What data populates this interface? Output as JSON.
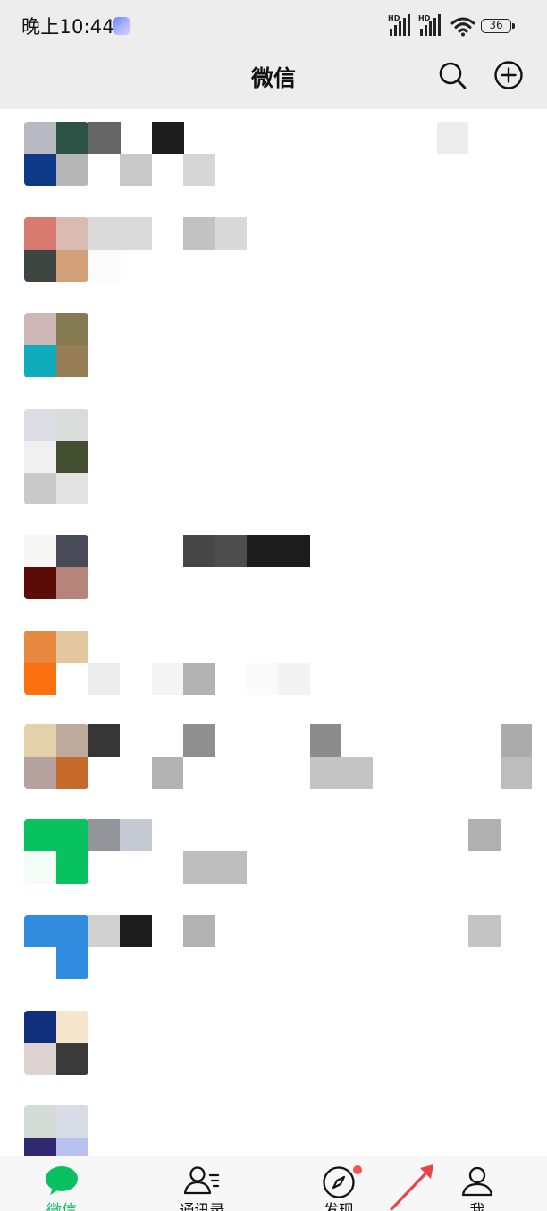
{
  "status_bar": {
    "time": "晚上10:44",
    "signal_1_label": "HD",
    "signal_2_label": "HD",
    "battery_level": "36",
    "icons": [
      "app-notification-icon",
      "signal-icon",
      "signal-icon",
      "wifi-icon",
      "battery-icon"
    ]
  },
  "header": {
    "title": "微信",
    "search_icon": "search-icon",
    "add_icon": "add-circle-icon"
  },
  "chat_list": {
    "rows": [
      {
        "avatar": [
          "#b9b9c4",
          "#2d5346",
          "#0d3a86",
          "#b7b7b7"
        ]
      },
      {
        "avatar": [
          "#d87a70",
          "#d9bbb1",
          "#3e4641",
          "#d2a17a"
        ]
      },
      {
        "avatar": [
          "#cdb7b6",
          "#847a52",
          "#10abbd",
          "#957e55"
        ]
      },
      {
        "avatar": [
          "#dcdce4",
          "#dadcdb",
          "#f0f0f0",
          "#434e31",
          "#c9c9c9",
          "#e3e3e3"
        ]
      },
      {
        "avatar": [
          "#f7f7f5",
          "#484a58",
          "#5b0c07",
          "#b6847a"
        ]
      },
      {
        "avatar": [
          "#e78a3f",
          "#e3c79f",
          "#fd700f",
          "#ffffff"
        ]
      },
      {
        "avatar": [
          "#e3d2a9",
          "#bcaa9c",
          "#b5a19e",
          "#c56a2a"
        ]
      },
      {
        "avatar": [
          "#07c25f",
          "#07c25f",
          "#f3fcf6",
          "#07c25f"
        ]
      },
      {
        "avatar": [
          "#2f8cdf",
          "#2f8cdf",
          "#ffffff",
          "#2f8cdf"
        ]
      },
      {
        "avatar": [
          "#102f7d",
          "#f5e6cc",
          "#ddd3d1",
          "#3a3a3a"
        ]
      },
      {
        "avatar": [
          "#d3ddd6",
          "#d7dce6",
          "#30296f",
          "#b8c1ee"
        ]
      }
    ]
  },
  "tab_bar": {
    "tabs": [
      {
        "label": "微信",
        "icon": "chat-bubble-icon",
        "active": true
      },
      {
        "label": "通讯录",
        "icon": "contacts-icon",
        "active": false
      },
      {
        "label": "发现",
        "icon": "compass-icon",
        "active": false,
        "badge": true
      },
      {
        "label": "我",
        "icon": "person-icon",
        "active": false
      }
    ],
    "active_color": "#07c160"
  },
  "annotation": {
    "arrow_color": "#e8434a",
    "icon": "arrow-annotation-icon"
  }
}
